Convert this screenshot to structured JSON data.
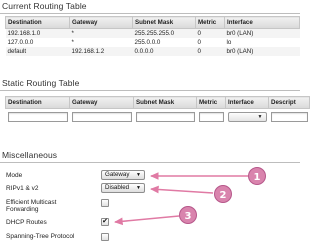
{
  "current_routing": {
    "title": "Current Routing Table",
    "columns": [
      "Destination",
      "Gateway",
      "Subnet Mask",
      "Metric",
      "Interface"
    ],
    "rows": [
      [
        "192.168.1.0",
        "*",
        "255.255.255.0",
        "0",
        "br0 (LAN)"
      ],
      [
        "127.0.0.0",
        "*",
        "255.0.0.0",
        "0",
        "lo"
      ],
      [
        "default",
        "192.168.1.2",
        "0.0.0.0",
        "0",
        "br0 (LAN)"
      ]
    ]
  },
  "static_routing": {
    "title": "Static Routing Table",
    "columns": [
      "Destination",
      "Gateway",
      "Subnet Mask",
      "Metric",
      "Interface",
      "Descript"
    ]
  },
  "misc": {
    "title": "Miscellaneous",
    "mode_label": "Mode",
    "mode_value": "Gateway",
    "rip_label": "RIPv1 & v2",
    "rip_value": "Disabled",
    "multicast_label": "Efficient Multicast Forwarding",
    "multicast_checked": false,
    "dhcp_label": "DHCP Routes",
    "dhcp_checked": true,
    "stp_label": "Spanning-Tree Protocol",
    "stp_checked": false
  },
  "annotations": {
    "color": "#e07aa4",
    "badges": [
      "1",
      "2",
      "3"
    ]
  }
}
